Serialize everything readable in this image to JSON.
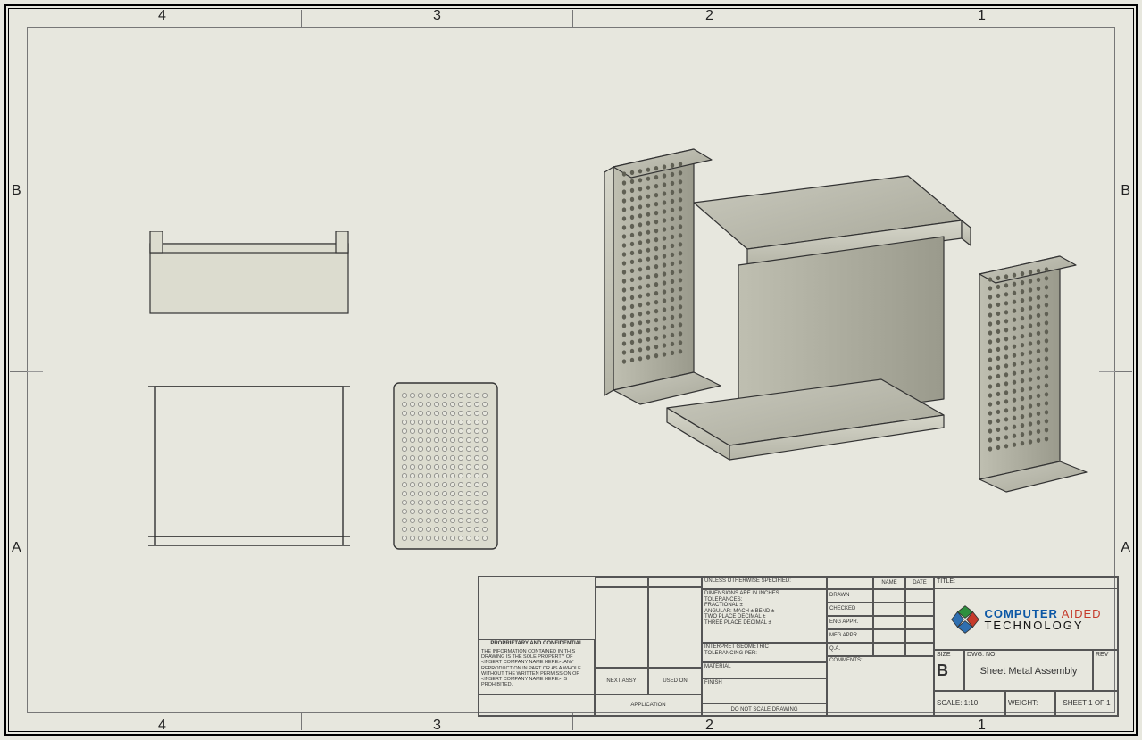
{
  "zones": {
    "cols": [
      "4",
      "3",
      "2",
      "1"
    ],
    "rows": [
      "B",
      "A"
    ]
  },
  "titleblock": {
    "title_label": "TITLE:",
    "size_label": "SIZE",
    "size": "B",
    "dwg_no_label": "DWG.  NO.",
    "dwg_no": "Sheet Metal Assembly",
    "rev_label": "REV",
    "scale_label": "SCALE: 1:10",
    "weight_label": "WEIGHT:",
    "sheet_label": "SHEET 1 OF 1",
    "unless": "UNLESS OTHERWISE SPECIFIED:",
    "dims": "DIMENSIONS ARE IN INCHES\nTOLERANCES:\nFRACTIONAL ±\nANGULAR: MACH ±   BEND ±\nTWO PLACE DECIMAL   ±\nTHREE PLACE DECIMAL  ±",
    "geo": "INTERPRET GEOMETRIC\nTOLERANCING PER:",
    "material": "MATERIAL",
    "finish": "FINISH",
    "do_not_scale": "DO NOT SCALE DRAWING",
    "application": "APPLICATION",
    "next_assy": "NEXT ASSY",
    "used_on": "USED ON",
    "name": "NAME",
    "date": "DATE",
    "rows": [
      "DRAWN",
      "CHECKED",
      "ENG APPR.",
      "MFG APPR.",
      "Q.A.",
      "COMMENTS:"
    ],
    "prop_title": "PROPRIETARY AND CONFIDENTIAL",
    "prop_body": "THE INFORMATION CONTAINED IN THIS DRAWING IS THE SOLE PROPERTY OF <INSERT COMPANY NAME HERE>. ANY REPRODUCTION IN PART OR AS A WHOLE WITHOUT THE WRITTEN PERMISSION OF <INSERT COMPANY NAME HERE> IS PROHIBITED."
  },
  "logo": {
    "line1a": "COMPUTER",
    "line1b": "AIDED",
    "line2": "TECHNOLOGY"
  }
}
